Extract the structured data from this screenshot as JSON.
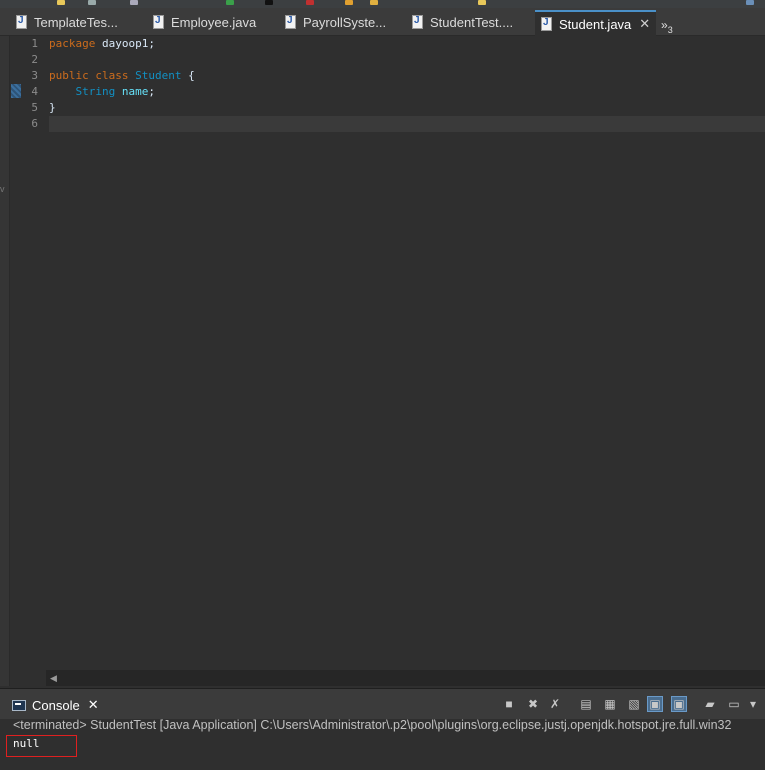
{
  "tabs": [
    {
      "label": "TemplateTes..."
    },
    {
      "label": "Employee.java"
    },
    {
      "label": "PayrollSyste..."
    },
    {
      "label": "StudentTest...."
    },
    {
      "label": "Student.java",
      "active": true
    }
  ],
  "tab_overflow": {
    "symbol": "»",
    "count": "3"
  },
  "editor": {
    "line_numbers": [
      "1",
      "2",
      "3",
      "4",
      "5",
      "6"
    ],
    "lines": [
      {
        "kw1": "package",
        "rest": " dayoop1;"
      },
      {},
      {
        "kw1": "public",
        "kw2": "class",
        "cls": "Student",
        "rest": " {"
      },
      {
        "indent": "    ",
        "cls": "String",
        "fld": "name",
        "rest": ";"
      },
      {
        "rest": "}"
      },
      {}
    ]
  },
  "console": {
    "tab_label": "Console",
    "terminated_text": "<terminated> StudentTest [Java Application] C:\\Users\\Administrator\\.p2\\pool\\plugins\\org.eclipse.justj.openjdk.hotspot.jre.full.win32",
    "output": "null"
  },
  "colors": {
    "background": "#2f2f2f",
    "keyword": "#cc6c1d",
    "class_name": "#1290c3",
    "field": "#66e1f8",
    "highlight_box": "#e02020"
  }
}
